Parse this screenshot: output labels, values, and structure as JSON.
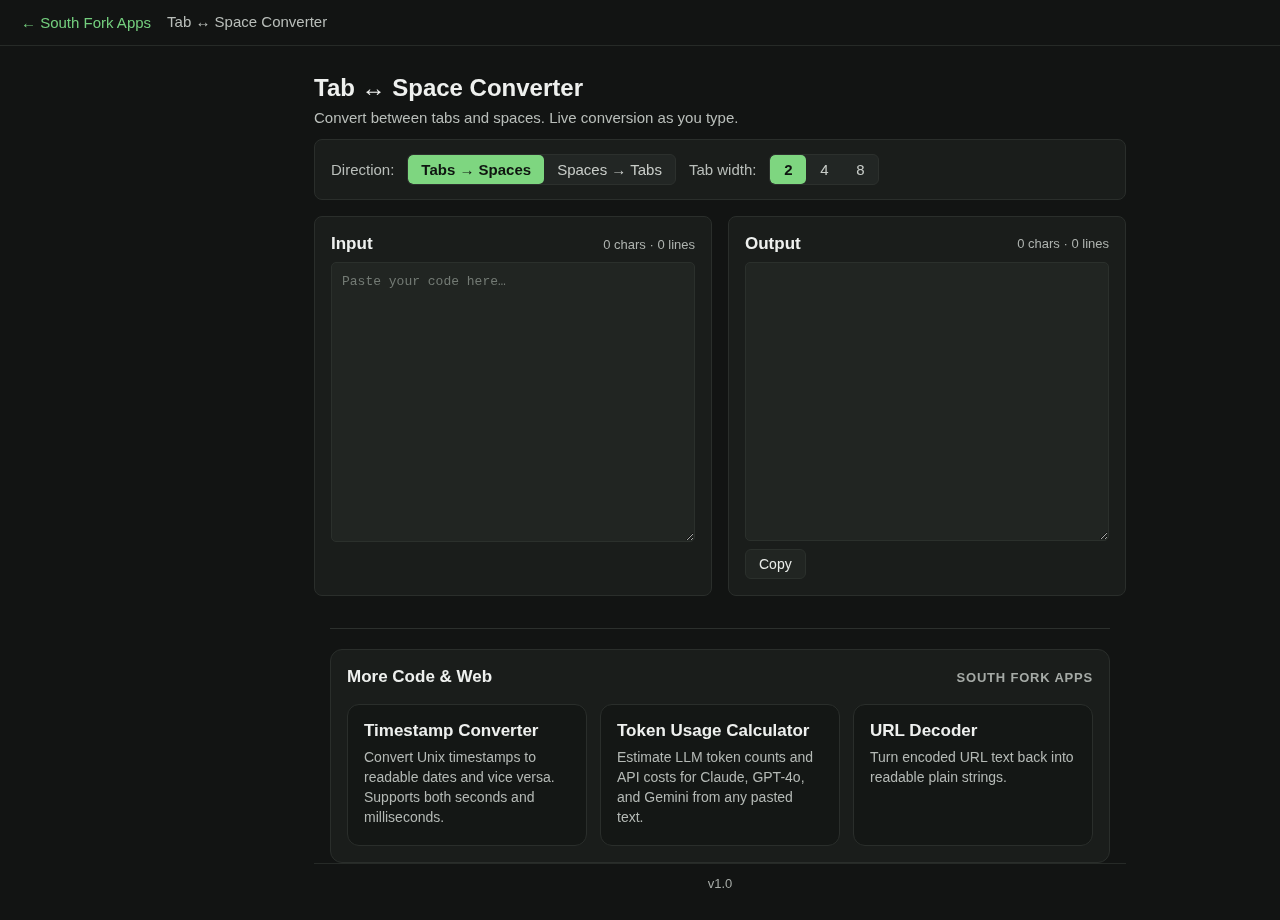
{
  "header": {
    "back_link": "← South Fork Apps",
    "title": "Tab ↔ Space Converter"
  },
  "page": {
    "title": "Tab ↔ Space Converter",
    "subtitle": "Convert between tabs and spaces. Live conversion as you type."
  },
  "controls": {
    "direction": {
      "label": "Direction:",
      "options": [
        {
          "label": "Tabs → Spaces",
          "selected": true
        },
        {
          "label": "Spaces → Tabs",
          "selected": false
        }
      ]
    },
    "tab_width": {
      "label": "Tab width:",
      "options": [
        {
          "label": "2",
          "selected": true
        },
        {
          "label": "4",
          "selected": false
        },
        {
          "label": "8",
          "selected": false
        }
      ]
    }
  },
  "panels": [
    {
      "kind": "input",
      "title": "Input",
      "stats": "0 chars · 0 lines",
      "placeholder": "Paste your code here…"
    },
    {
      "kind": "output",
      "title": "Output",
      "stats": "0 chars · 0 lines",
      "button": "Copy"
    }
  ],
  "related": {
    "title": "More Code & Web",
    "brand": "SOUTH FORK APPS",
    "cards": [
      {
        "title": "Timestamp Converter",
        "description": "Convert Unix timestamps to readable dates and vice versa. Supports both seconds and milliseconds."
      },
      {
        "title": "Token Usage Calculator",
        "description": "Estimate LLM token counts and API costs for Claude, GPT-4o, and Gemini from any pasted text."
      },
      {
        "title": "URL Decoder",
        "description": "Turn encoded URL text back into readable plain strings."
      }
    ]
  },
  "footer": {
    "version": "v1.0"
  }
}
